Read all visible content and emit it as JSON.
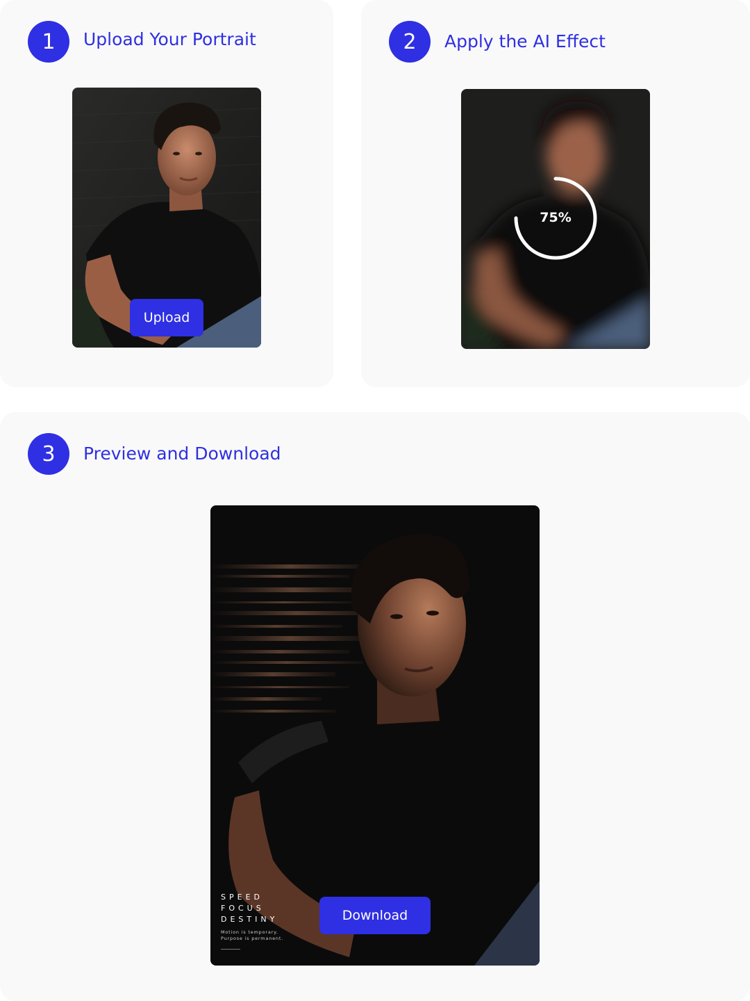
{
  "steps": [
    {
      "number": "1",
      "title": "Upload Your Portrait",
      "button_label": "Upload"
    },
    {
      "number": "2",
      "title": "Apply the AI Effect",
      "progress_label": "75%",
      "progress_fraction": 0.75
    },
    {
      "number": "3",
      "title": "Preview and Download",
      "button_label": "Download"
    }
  ],
  "poster": {
    "lines": [
      "SPEED",
      "FOCUS",
      "DESTINY"
    ],
    "tagline_1": "Motion is temporary.",
    "tagline_2": "Purpose is permanent."
  },
  "colors": {
    "accent": "#2f2fe3",
    "card": "#f9f9f9",
    "photo_dark": "#1b1b1b"
  },
  "icons": [
    "progress-ring-icon"
  ]
}
